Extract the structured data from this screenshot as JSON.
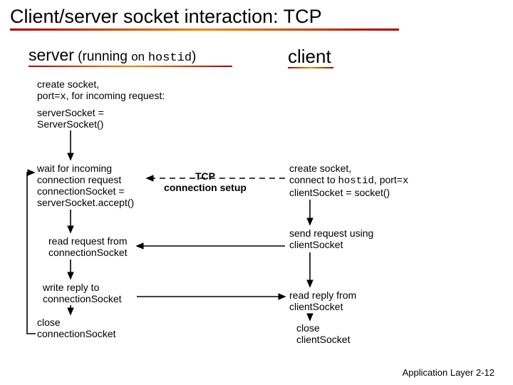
{
  "title": "Client/server socket interaction: TCP",
  "server_header": {
    "a": "server",
    "b": " (running ",
    "c": "on ",
    "d": "hostid",
    "e": ")"
  },
  "client_header": "client",
  "server": {
    "create1": "create socket,",
    "create2a": "port=",
    "create2b": "x",
    "create2c": ", for incoming request:",
    "create3": "serverSocket =",
    "create4": "ServerSocket()",
    "wait1": "wait for incoming",
    "wait2": "connection request",
    "wait3": "connectionSocket = ",
    "wait4": "serverSocket.accept()",
    "read1": "read request from",
    "read2": "connectionSocket",
    "write1": "write reply to",
    "write2": " connectionSocket",
    "close1": "close",
    "close2": "connectionSocket"
  },
  "tcp": {
    "l1": "TCP ",
    "l2": "connection setup"
  },
  "client": {
    "create1": "create socket,",
    "create2a": "connect to ",
    "create2b": "hostid",
    "create2c": ", port=",
    "create2d": "x",
    "create3": "clientSocket = socket()",
    "send1": "send request using",
    "send2": "clientSocket",
    "read1": "read reply from",
    "read2": "clientSocket",
    "close1": "close",
    "close2": "clientSocket"
  },
  "footer": {
    "a": "Application Layer",
    "b": " 2-12"
  }
}
